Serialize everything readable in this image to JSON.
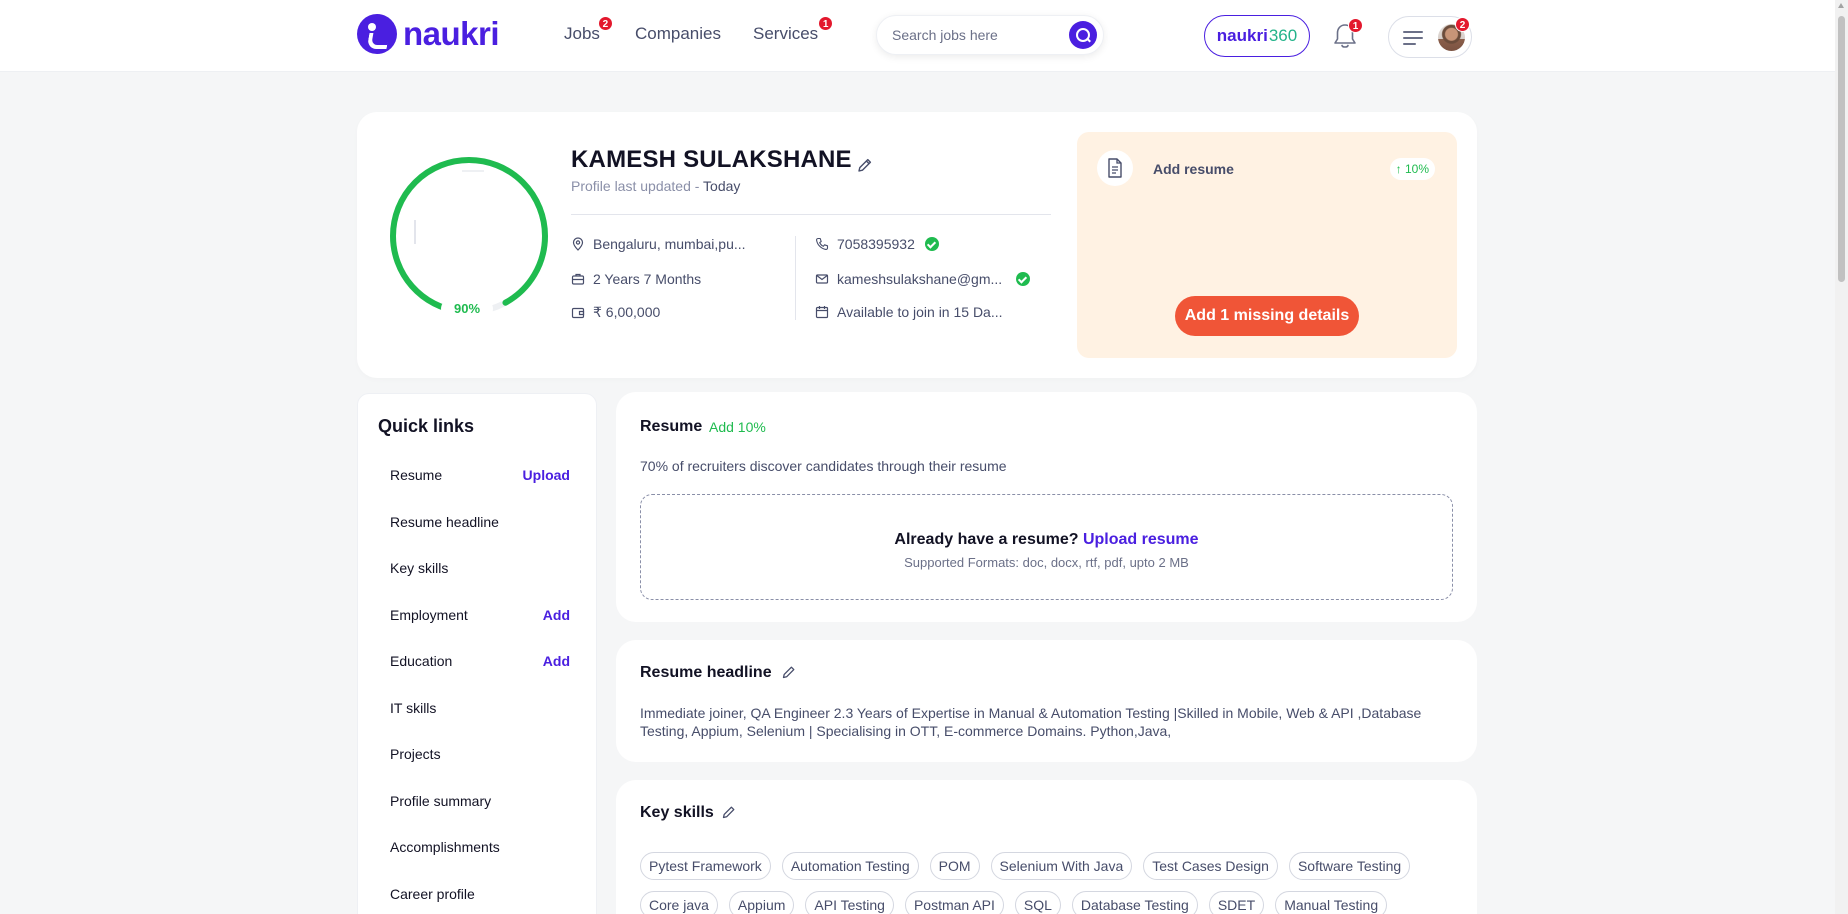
{
  "header": {
    "logo_text": "naukri",
    "nav": [
      {
        "label": "Jobs",
        "badge": "2"
      },
      {
        "label": "Companies"
      },
      {
        "label": "Services",
        "badge": "1"
      }
    ],
    "search_placeholder": "Search jobs here",
    "naukri360_brand": "naukri",
    "naukri360_num": "360",
    "notification_badge": "1",
    "profile_badge": "2"
  },
  "profile": {
    "name": "KAMESH SULAKSHANE",
    "updated_label": "Profile last updated - ",
    "updated_value": "Today",
    "completion": "90%",
    "completion_value": 0.9,
    "location": "Bengaluru, mumbai,pu...",
    "experience": "2 Years 7 Months",
    "salary": "₹ 6,00,000",
    "phone": "7058395932",
    "email": "kameshsulakshane@gm...",
    "notice": "Available to join in 15 Da..."
  },
  "missing": {
    "title": "Add resume",
    "pct": "↑ 10%",
    "button": "Add 1 missing details"
  },
  "quick_links": {
    "title": "Quick links",
    "items": [
      {
        "label": "Resume",
        "action": "Upload"
      },
      {
        "label": "Resume headline",
        "action": ""
      },
      {
        "label": "Key skills",
        "action": ""
      },
      {
        "label": "Employment",
        "action": "Add"
      },
      {
        "label": "Education",
        "action": "Add"
      },
      {
        "label": "IT skills",
        "action": ""
      },
      {
        "label": "Projects",
        "action": ""
      },
      {
        "label": "Profile summary",
        "action": ""
      },
      {
        "label": "Accomplishments",
        "action": ""
      },
      {
        "label": "Career profile",
        "action": ""
      }
    ]
  },
  "resume_card": {
    "title": "Resume",
    "add": "Add 10%",
    "text": "70% of recruiters discover candidates through their resume",
    "question": "Already have a resume? ",
    "upload_link": "Upload resume",
    "formats": "Supported Formats: doc, docx, rtf, pdf, upto 2 MB"
  },
  "headline_card": {
    "title": "Resume headline",
    "text": "Immediate joiner, QA Engineer 2.3 Years of Expertise in Manual & Automation Testing |Skilled in Mobile, Web & API ,Database Testing, Appium, Selenium | Specialising in OTT, E-commerce Domains. Python,Java,"
  },
  "skills_card": {
    "title": "Key skills",
    "skills": [
      "Pytest Framework",
      "Automation Testing",
      "POM",
      "Selenium With Java",
      "Test Cases Design",
      "Software Testing",
      "Core java",
      "Appium",
      "API Testing",
      "Postman API",
      "SQL",
      "Database Testing",
      "SDET",
      "Manual Testing"
    ]
  },
  "colors": {
    "brand": "#4a1fe0",
    "success": "#1fbb4f",
    "cta": "#f05537",
    "badge": "#e3182d"
  }
}
